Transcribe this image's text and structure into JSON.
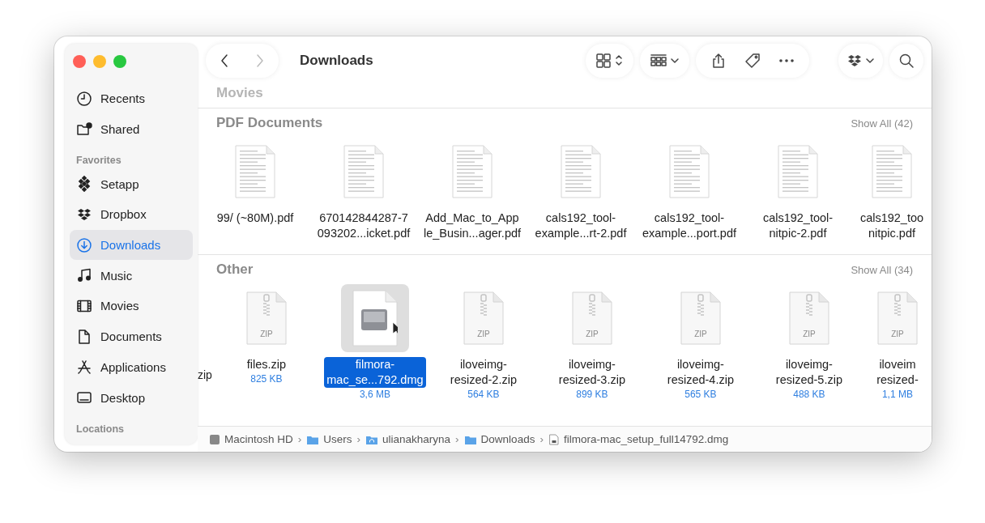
{
  "window": {
    "title": "Downloads"
  },
  "toolbar": {
    "back": {
      "disabled": false
    },
    "forward": {
      "disabled": true
    }
  },
  "sidebar": {
    "items": [
      {
        "label": "Recents",
        "kind": "clock",
        "selected": false
      },
      {
        "label": "Shared",
        "kind": "shared",
        "selected": false
      }
    ],
    "sections": [
      {
        "title": "Favorites",
        "items": [
          {
            "label": "Setapp",
            "kind": "setapp",
            "selected": false
          },
          {
            "label": "Dropbox",
            "kind": "dropbox",
            "selected": false
          },
          {
            "label": "Downloads",
            "kind": "download",
            "selected": true
          },
          {
            "label": "Music",
            "kind": "music",
            "selected": false
          },
          {
            "label": "Movies",
            "kind": "film",
            "selected": false
          },
          {
            "label": "Documents",
            "kind": "doc",
            "selected": false
          },
          {
            "label": "Applications",
            "kind": "apps",
            "selected": false
          },
          {
            "label": "Desktop",
            "kind": "desktop",
            "selected": false
          }
        ]
      },
      {
        "title": "Locations"
      }
    ]
  },
  "sections": [
    {
      "title": "Movies"
    },
    {
      "title": "PDF Documents",
      "show_all": "Show All (42)",
      "files": [
        {
          "kind": "pdf",
          "name": "99/ (~80M).pdf",
          "selected": false
        },
        {
          "kind": "pdf",
          "name": "670142844287-7\n093202...icket.pdf",
          "selected": false
        },
        {
          "kind": "pdf",
          "name": "Add_Mac_to_App\nle_Busin...ager.pdf",
          "selected": false
        },
        {
          "kind": "pdf",
          "name": "cals192_tool-\nexample...rt-2.pdf",
          "selected": false
        },
        {
          "kind": "pdf",
          "name": "cals192_tool-\nexample...port.pdf",
          "selected": false
        },
        {
          "kind": "pdf",
          "name": "cals192_tool-\nnitpic-2.pdf",
          "selected": false
        },
        {
          "kind": "pdf",
          "name": "cals192_too\nnitpic.pdf",
          "selected": false
        }
      ]
    },
    {
      "title": "Other",
      "show_all": "Show All (34)",
      "cut_label": "zip",
      "files": [
        {
          "kind": "zip",
          "badge": "ZIP",
          "name": "files.zip",
          "size": "825 KB",
          "selected": false
        },
        {
          "kind": "dmg",
          "name": "filmora-\nmac_se...792.dmg",
          "size": "3,6 MB",
          "selected": true
        },
        {
          "kind": "zip",
          "badge": "ZIP",
          "name": "iloveimg-\nresized-2.zip",
          "size": "564 KB",
          "selected": false
        },
        {
          "kind": "zip",
          "badge": "ZIP",
          "name": "iloveimg-\nresized-3.zip",
          "size": "899 KB",
          "selected": false
        },
        {
          "kind": "zip",
          "badge": "ZIP",
          "name": "iloveimg-\nresized-4.zip",
          "size": "565 KB",
          "selected": false
        },
        {
          "kind": "zip",
          "badge": "ZIP",
          "name": "iloveimg-\nresized-5.zip",
          "size": "488 KB",
          "selected": false
        },
        {
          "kind": "zip",
          "badge": "ZIP",
          "name": "iloveim\nresized-",
          "size": "1,1 MB",
          "selected": false
        }
      ]
    }
  ],
  "path_bar": [
    {
      "kind": "disk",
      "label": "Macintosh HD"
    },
    {
      "kind": "folder",
      "separator": "›",
      "label": "Users"
    },
    {
      "kind": "home",
      "separator": "›",
      "label": "ulianakharyna"
    },
    {
      "kind": "folder",
      "separator": "›",
      "label": "Downloads"
    },
    {
      "kind": "file",
      "separator": "›",
      "label": "filmora-mac_setup_full14792.dmg"
    }
  ]
}
